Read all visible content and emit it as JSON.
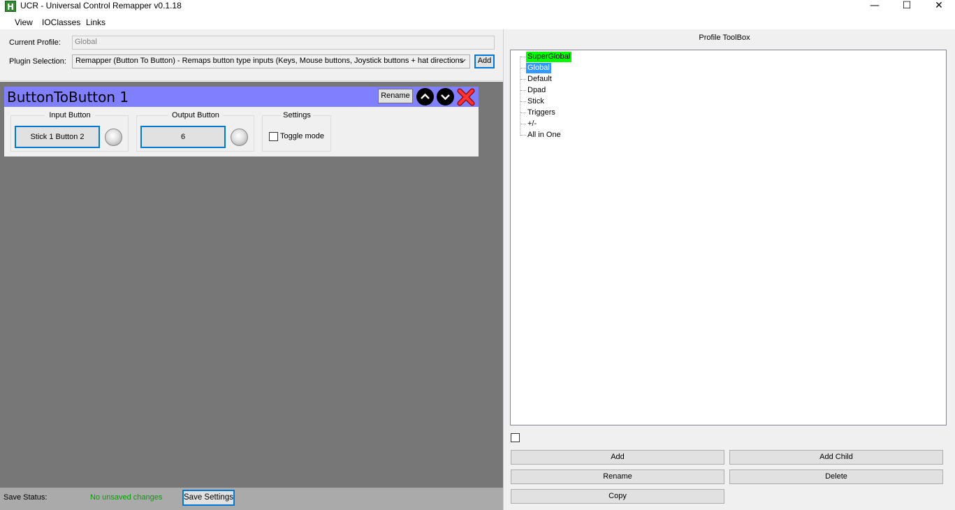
{
  "window": {
    "title": "UCR - Universal Control Remapper v0.1.18",
    "app_icon_glyph": "H",
    "minimize_glyph": "—",
    "maximize_glyph": "☐",
    "close_glyph": "✕"
  },
  "menu": {
    "items": [
      "View",
      "IOClasses",
      "Links"
    ]
  },
  "profile": {
    "current_profile_label": "Current Profile:",
    "current_profile_value": "Global",
    "plugin_selection_label": "Plugin Selection:",
    "plugin_selection_value": "Remapper (Button To Button)     - Remaps button type inputs (Keys, Mouse buttons, Joystick buttons + hat directions",
    "add_label": "Add"
  },
  "plugin": {
    "title": "ButtonToButton 1",
    "rename_label": "Rename",
    "input_group": {
      "title": "Input Button",
      "button_label": "Stick 1 Button 2"
    },
    "output_group": {
      "title": "Output Button",
      "button_label": "6"
    },
    "settings_group": {
      "title": "Settings",
      "toggle_label": "Toggle mode",
      "toggle_checked": false
    },
    "header_color": "#8080ff"
  },
  "status": {
    "label": "Save Status:",
    "value": "No unsaved changes",
    "value_color": "#00a000",
    "save_label": "Save Settings"
  },
  "toolbox": {
    "title": "Profile ToolBox",
    "tree": [
      {
        "label": "SuperGlobal",
        "highlight": "#00ff00"
      },
      {
        "label": "Global",
        "highlight": "#3399ff",
        "selected": true
      },
      {
        "label": "Default"
      },
      {
        "label": "Dpad"
      },
      {
        "label": "Stick"
      },
      {
        "label": "Triggers"
      },
      {
        "label": "+/-"
      },
      {
        "label": "All in One"
      }
    ],
    "buttons": {
      "add": "Add",
      "add_child": "Add Child",
      "rename": "Rename",
      "delete": "Delete",
      "copy": "Copy"
    }
  }
}
